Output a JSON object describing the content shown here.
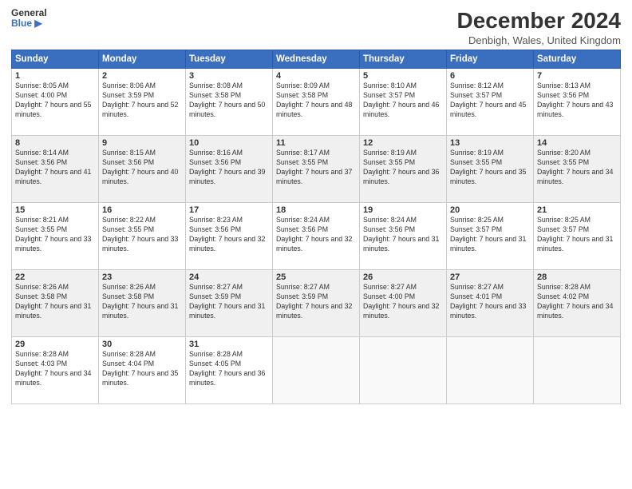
{
  "header": {
    "logo_line1": "General",
    "logo_line2": "Blue",
    "month_title": "December 2024",
    "location": "Denbigh, Wales, United Kingdom"
  },
  "weekdays": [
    "Sunday",
    "Monday",
    "Tuesday",
    "Wednesday",
    "Thursday",
    "Friday",
    "Saturday"
  ],
  "weeks": [
    [
      {
        "day": "1",
        "rise": "Sunrise: 8:05 AM",
        "set": "Sunset: 4:00 PM",
        "daylight": "Daylight: 7 hours and 55 minutes."
      },
      {
        "day": "2",
        "rise": "Sunrise: 8:06 AM",
        "set": "Sunset: 3:59 PM",
        "daylight": "Daylight: 7 hours and 52 minutes."
      },
      {
        "day": "3",
        "rise": "Sunrise: 8:08 AM",
        "set": "Sunset: 3:58 PM",
        "daylight": "Daylight: 7 hours and 50 minutes."
      },
      {
        "day": "4",
        "rise": "Sunrise: 8:09 AM",
        "set": "Sunset: 3:58 PM",
        "daylight": "Daylight: 7 hours and 48 minutes."
      },
      {
        "day": "5",
        "rise": "Sunrise: 8:10 AM",
        "set": "Sunset: 3:57 PM",
        "daylight": "Daylight: 7 hours and 46 minutes."
      },
      {
        "day": "6",
        "rise": "Sunrise: 8:12 AM",
        "set": "Sunset: 3:57 PM",
        "daylight": "Daylight: 7 hours and 45 minutes."
      },
      {
        "day": "7",
        "rise": "Sunrise: 8:13 AM",
        "set": "Sunset: 3:56 PM",
        "daylight": "Daylight: 7 hours and 43 minutes."
      }
    ],
    [
      {
        "day": "8",
        "rise": "Sunrise: 8:14 AM",
        "set": "Sunset: 3:56 PM",
        "daylight": "Daylight: 7 hours and 41 minutes."
      },
      {
        "day": "9",
        "rise": "Sunrise: 8:15 AM",
        "set": "Sunset: 3:56 PM",
        "daylight": "Daylight: 7 hours and 40 minutes."
      },
      {
        "day": "10",
        "rise": "Sunrise: 8:16 AM",
        "set": "Sunset: 3:56 PM",
        "daylight": "Daylight: 7 hours and 39 minutes."
      },
      {
        "day": "11",
        "rise": "Sunrise: 8:17 AM",
        "set": "Sunset: 3:55 PM",
        "daylight": "Daylight: 7 hours and 37 minutes."
      },
      {
        "day": "12",
        "rise": "Sunrise: 8:19 AM",
        "set": "Sunset: 3:55 PM",
        "daylight": "Daylight: 7 hours and 36 minutes."
      },
      {
        "day": "13",
        "rise": "Sunrise: 8:19 AM",
        "set": "Sunset: 3:55 PM",
        "daylight": "Daylight: 7 hours and 35 minutes."
      },
      {
        "day": "14",
        "rise": "Sunrise: 8:20 AM",
        "set": "Sunset: 3:55 PM",
        "daylight": "Daylight: 7 hours and 34 minutes."
      }
    ],
    [
      {
        "day": "15",
        "rise": "Sunrise: 8:21 AM",
        "set": "Sunset: 3:55 PM",
        "daylight": "Daylight: 7 hours and 33 minutes."
      },
      {
        "day": "16",
        "rise": "Sunrise: 8:22 AM",
        "set": "Sunset: 3:55 PM",
        "daylight": "Daylight: 7 hours and 33 minutes."
      },
      {
        "day": "17",
        "rise": "Sunrise: 8:23 AM",
        "set": "Sunset: 3:56 PM",
        "daylight": "Daylight: 7 hours and 32 minutes."
      },
      {
        "day": "18",
        "rise": "Sunrise: 8:24 AM",
        "set": "Sunset: 3:56 PM",
        "daylight": "Daylight: 7 hours and 32 minutes."
      },
      {
        "day": "19",
        "rise": "Sunrise: 8:24 AM",
        "set": "Sunset: 3:56 PM",
        "daylight": "Daylight: 7 hours and 31 minutes."
      },
      {
        "day": "20",
        "rise": "Sunrise: 8:25 AM",
        "set": "Sunset: 3:57 PM",
        "daylight": "Daylight: 7 hours and 31 minutes."
      },
      {
        "day": "21",
        "rise": "Sunrise: 8:25 AM",
        "set": "Sunset: 3:57 PM",
        "daylight": "Daylight: 7 hours and 31 minutes."
      }
    ],
    [
      {
        "day": "22",
        "rise": "Sunrise: 8:26 AM",
        "set": "Sunset: 3:58 PM",
        "daylight": "Daylight: 7 hours and 31 minutes."
      },
      {
        "day": "23",
        "rise": "Sunrise: 8:26 AM",
        "set": "Sunset: 3:58 PM",
        "daylight": "Daylight: 7 hours and 31 minutes."
      },
      {
        "day": "24",
        "rise": "Sunrise: 8:27 AM",
        "set": "Sunset: 3:59 PM",
        "daylight": "Daylight: 7 hours and 31 minutes."
      },
      {
        "day": "25",
        "rise": "Sunrise: 8:27 AM",
        "set": "Sunset: 3:59 PM",
        "daylight": "Daylight: 7 hours and 32 minutes."
      },
      {
        "day": "26",
        "rise": "Sunrise: 8:27 AM",
        "set": "Sunset: 4:00 PM",
        "daylight": "Daylight: 7 hours and 32 minutes."
      },
      {
        "day": "27",
        "rise": "Sunrise: 8:27 AM",
        "set": "Sunset: 4:01 PM",
        "daylight": "Daylight: 7 hours and 33 minutes."
      },
      {
        "day": "28",
        "rise": "Sunrise: 8:28 AM",
        "set": "Sunset: 4:02 PM",
        "daylight": "Daylight: 7 hours and 34 minutes."
      }
    ],
    [
      {
        "day": "29",
        "rise": "Sunrise: 8:28 AM",
        "set": "Sunset: 4:03 PM",
        "daylight": "Daylight: 7 hours and 34 minutes."
      },
      {
        "day": "30",
        "rise": "Sunrise: 8:28 AM",
        "set": "Sunset: 4:04 PM",
        "daylight": "Daylight: 7 hours and 35 minutes."
      },
      {
        "day": "31",
        "rise": "Sunrise: 8:28 AM",
        "set": "Sunset: 4:05 PM",
        "daylight": "Daylight: 7 hours and 36 minutes."
      },
      null,
      null,
      null,
      null
    ]
  ]
}
